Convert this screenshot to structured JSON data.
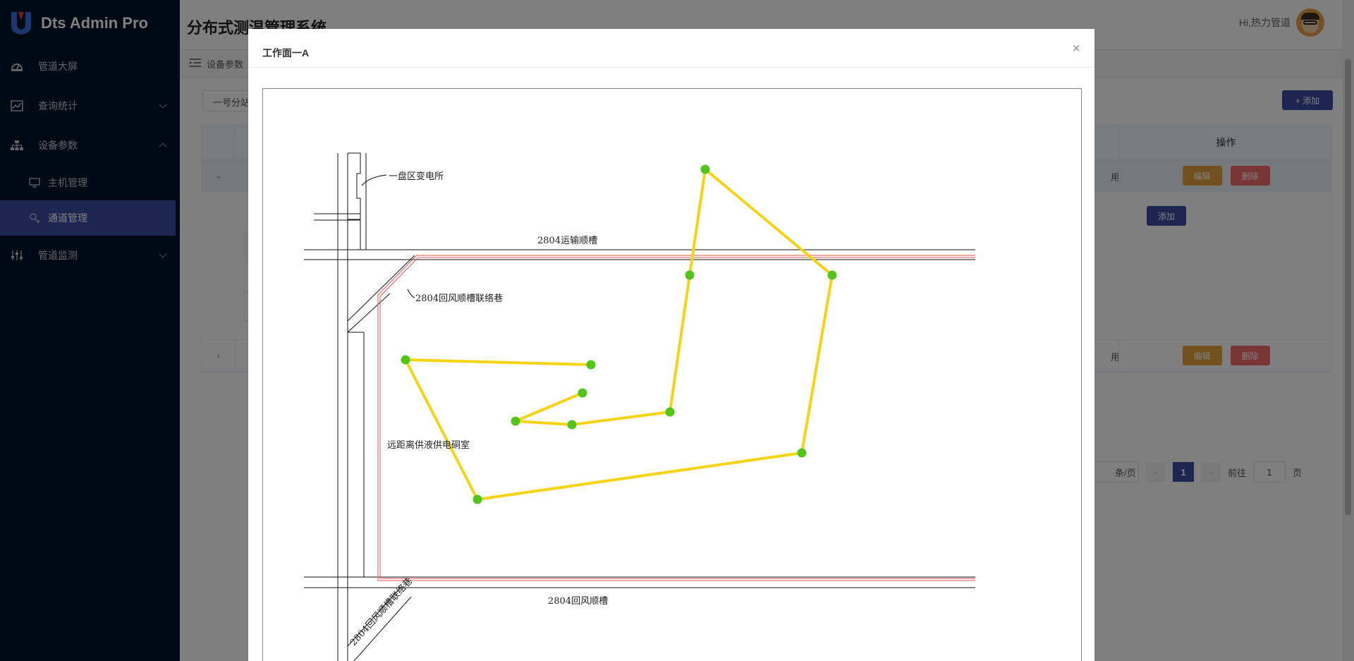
{
  "app": {
    "name": "Dts Admin Pro",
    "brand_color": "#3a4ca0"
  },
  "sidebar": {
    "items": [
      {
        "label": "管道大屏",
        "icon": "dashboard-icon"
      },
      {
        "label": "查询统计",
        "icon": "chart-line-icon"
      },
      {
        "label": "设备参数",
        "icon": "network-icon",
        "expanded": true,
        "children": [
          {
            "label": "主机管理",
            "icon": "monitor-icon"
          },
          {
            "label": "通道管理",
            "icon": "channel-icon",
            "active": true
          }
        ]
      },
      {
        "label": "管道监测",
        "icon": "sliders-icon"
      }
    ]
  },
  "header": {
    "title": "分布式测温管理系统",
    "greeting": "Hi,热力管道"
  },
  "breadcrumb": {
    "label": "设备参数"
  },
  "filter": {
    "station_value": "一号分站"
  },
  "toolbar": {
    "add_label": "+ 添加"
  },
  "table": {
    "ops_header": "操作",
    "edit_label": "编辑",
    "delete_label": "删除",
    "rows": [
      {
        "status_tail": "用",
        "expand": "⌄"
      },
      {
        "status_tail": "用",
        "expand": "›"
      }
    ],
    "inner": {
      "add_label": "添加",
      "ops_header": "操作",
      "edit_label": "辑",
      "delete_label": "删除"
    }
  },
  "pagination": {
    "page_size_text": "条/页",
    "current_page": "1",
    "goto_prefix": "前往",
    "goto_value": "1",
    "goto_suffix": "页",
    "prev": "‹",
    "next": "›"
  },
  "modal": {
    "title": "工作面一A",
    "close": "×",
    "map_labels": {
      "substation": "一盘区变电所",
      "transport_road": "2804运输顺槽",
      "return_air_link": "2804回风顺槽联络巷",
      "power_chamber": "远距离供液供电硐室",
      "return_air_road": "2804回风顺槽",
      "return_air_link_lower": "2804回风顺槽联络巷"
    },
    "route_color": "#f5d416",
    "node_color": "#52c41a"
  }
}
